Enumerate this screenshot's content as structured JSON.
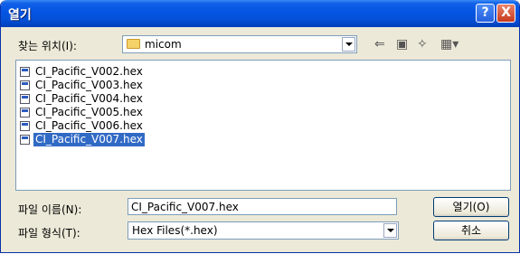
{
  "window": {
    "title": "열기",
    "help_label": "?",
    "close_label": "X"
  },
  "lookin": {
    "label": "찾는 위치(I):",
    "value": "micom"
  },
  "files": [
    {
      "name": "CI_Pacific_V002.hex",
      "selected": false
    },
    {
      "name": "CI_Pacific_V003.hex",
      "selected": false
    },
    {
      "name": "CI_Pacific_V004.hex",
      "selected": false
    },
    {
      "name": "CI_Pacific_V005.hex",
      "selected": false
    },
    {
      "name": "CI_Pacific_V006.hex",
      "selected": false
    },
    {
      "name": "CI_Pacific_V007.hex",
      "selected": true
    }
  ],
  "filename": {
    "label": "파일 이름(N):",
    "value": "CI_Pacific_V007.hex"
  },
  "filetype": {
    "label": "파일 형식(T):",
    "value": "Hex Files(*.hex)"
  },
  "buttons": {
    "open": "열기(O)",
    "cancel": "취소"
  },
  "colors": {
    "titlebar": "#0554e3",
    "selection": "#316ac5",
    "dialog_bg": "#ece9d8"
  }
}
